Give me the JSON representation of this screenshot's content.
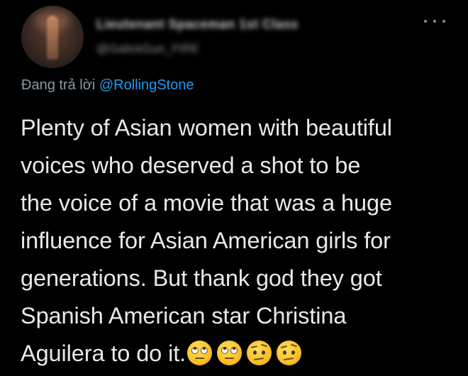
{
  "tweet": {
    "author": {
      "display_name": "Lieutenant Spaceman 1st Class",
      "handle": "@GalickGun_FIRE"
    },
    "reply_context": {
      "prefix": "Đang trả lời",
      "mention": "@RollingStone"
    },
    "text_lines": [
      "Plenty of Asian women with beautiful",
      "voices who deserved a shot to be",
      "the voice of a movie that was a huge",
      "influence for Asian American girls for",
      "generations. But thank god they got",
      "Spanish American star Christina",
      "Aguilera to do it."
    ],
    "emojis": [
      "face-with-rolling-eyes",
      "face-with-rolling-eyes",
      "face-with-raised-eyebrow",
      "face-with-raised-eyebrow"
    ],
    "more_icon": "more-horizontal-icon"
  },
  "colors": {
    "background": "#000000",
    "text": "#e7e9ea",
    "secondary_text": "#8b98a5",
    "link": "#1d9bf0"
  }
}
